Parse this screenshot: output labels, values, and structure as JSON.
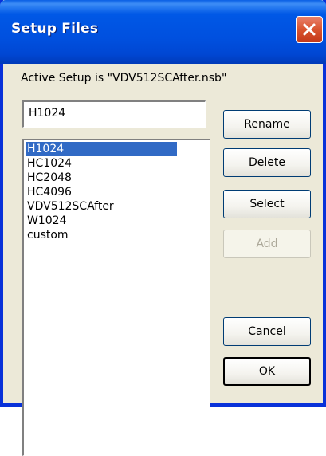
{
  "window": {
    "title": "Setup Files",
    "close_icon": "close-x-icon",
    "colors": {
      "titlebar": "#0050df",
      "body": "#ece9d8",
      "selection": "#316ac5",
      "close": "#d9542f"
    }
  },
  "dialog": {
    "active_setup_label": "Active Setup is \"VDV512SCAfter.nsb\"",
    "name_field_value": "H1024",
    "list": {
      "selected_index": 0,
      "items": [
        "H1024",
        "HC1024",
        "HC2048",
        "HC4096",
        "VDV512SCAfter",
        "W1024",
        "custom"
      ]
    },
    "buttons": {
      "rename": "Rename",
      "delete": "Delete",
      "select": "Select",
      "add": "Add",
      "cancel": "Cancel",
      "ok": "OK"
    }
  }
}
